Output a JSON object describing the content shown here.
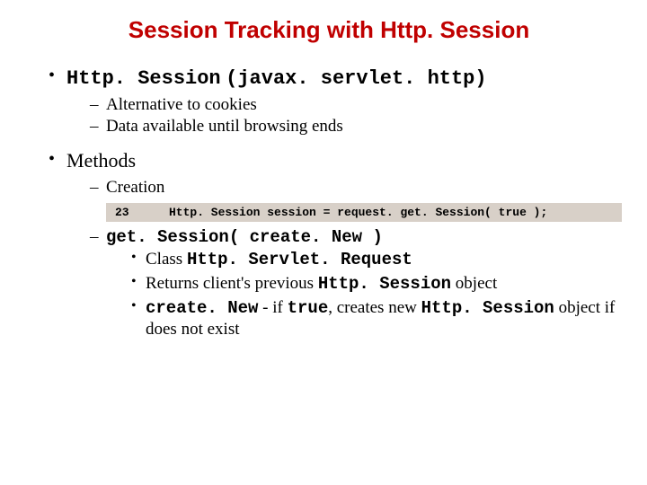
{
  "title": "Session Tracking with Http. Session",
  "b1_mono": "Http. Session",
  "b1_pkg": "(javax. servlet. http)",
  "b1_sub1": "Alternative to cookies",
  "b1_sub2": "Data available until browsing ends",
  "b2": "Methods",
  "b2_sub1": "Creation",
  "code_ln": "23",
  "code_txt": "Http. Session session = request. get. Session( true );",
  "b2_sub2": "get. Session( create. New )",
  "b2_s2_i1_a": "Class ",
  "b2_s2_i1_b": "Http. Servlet. Request",
  "b2_s2_i2_a": "Returns client's previous ",
  "b2_s2_i2_b": "Http. Session",
  "b2_s2_i2_c": " object",
  "b2_s2_i3_a": "create. New",
  "b2_s2_i3_b": " - if ",
  "b2_s2_i3_c": "true",
  "b2_s2_i3_d": ", creates new ",
  "b2_s2_i3_e": "Http. Session",
  "b2_s2_i3_f": " object if does not exist"
}
